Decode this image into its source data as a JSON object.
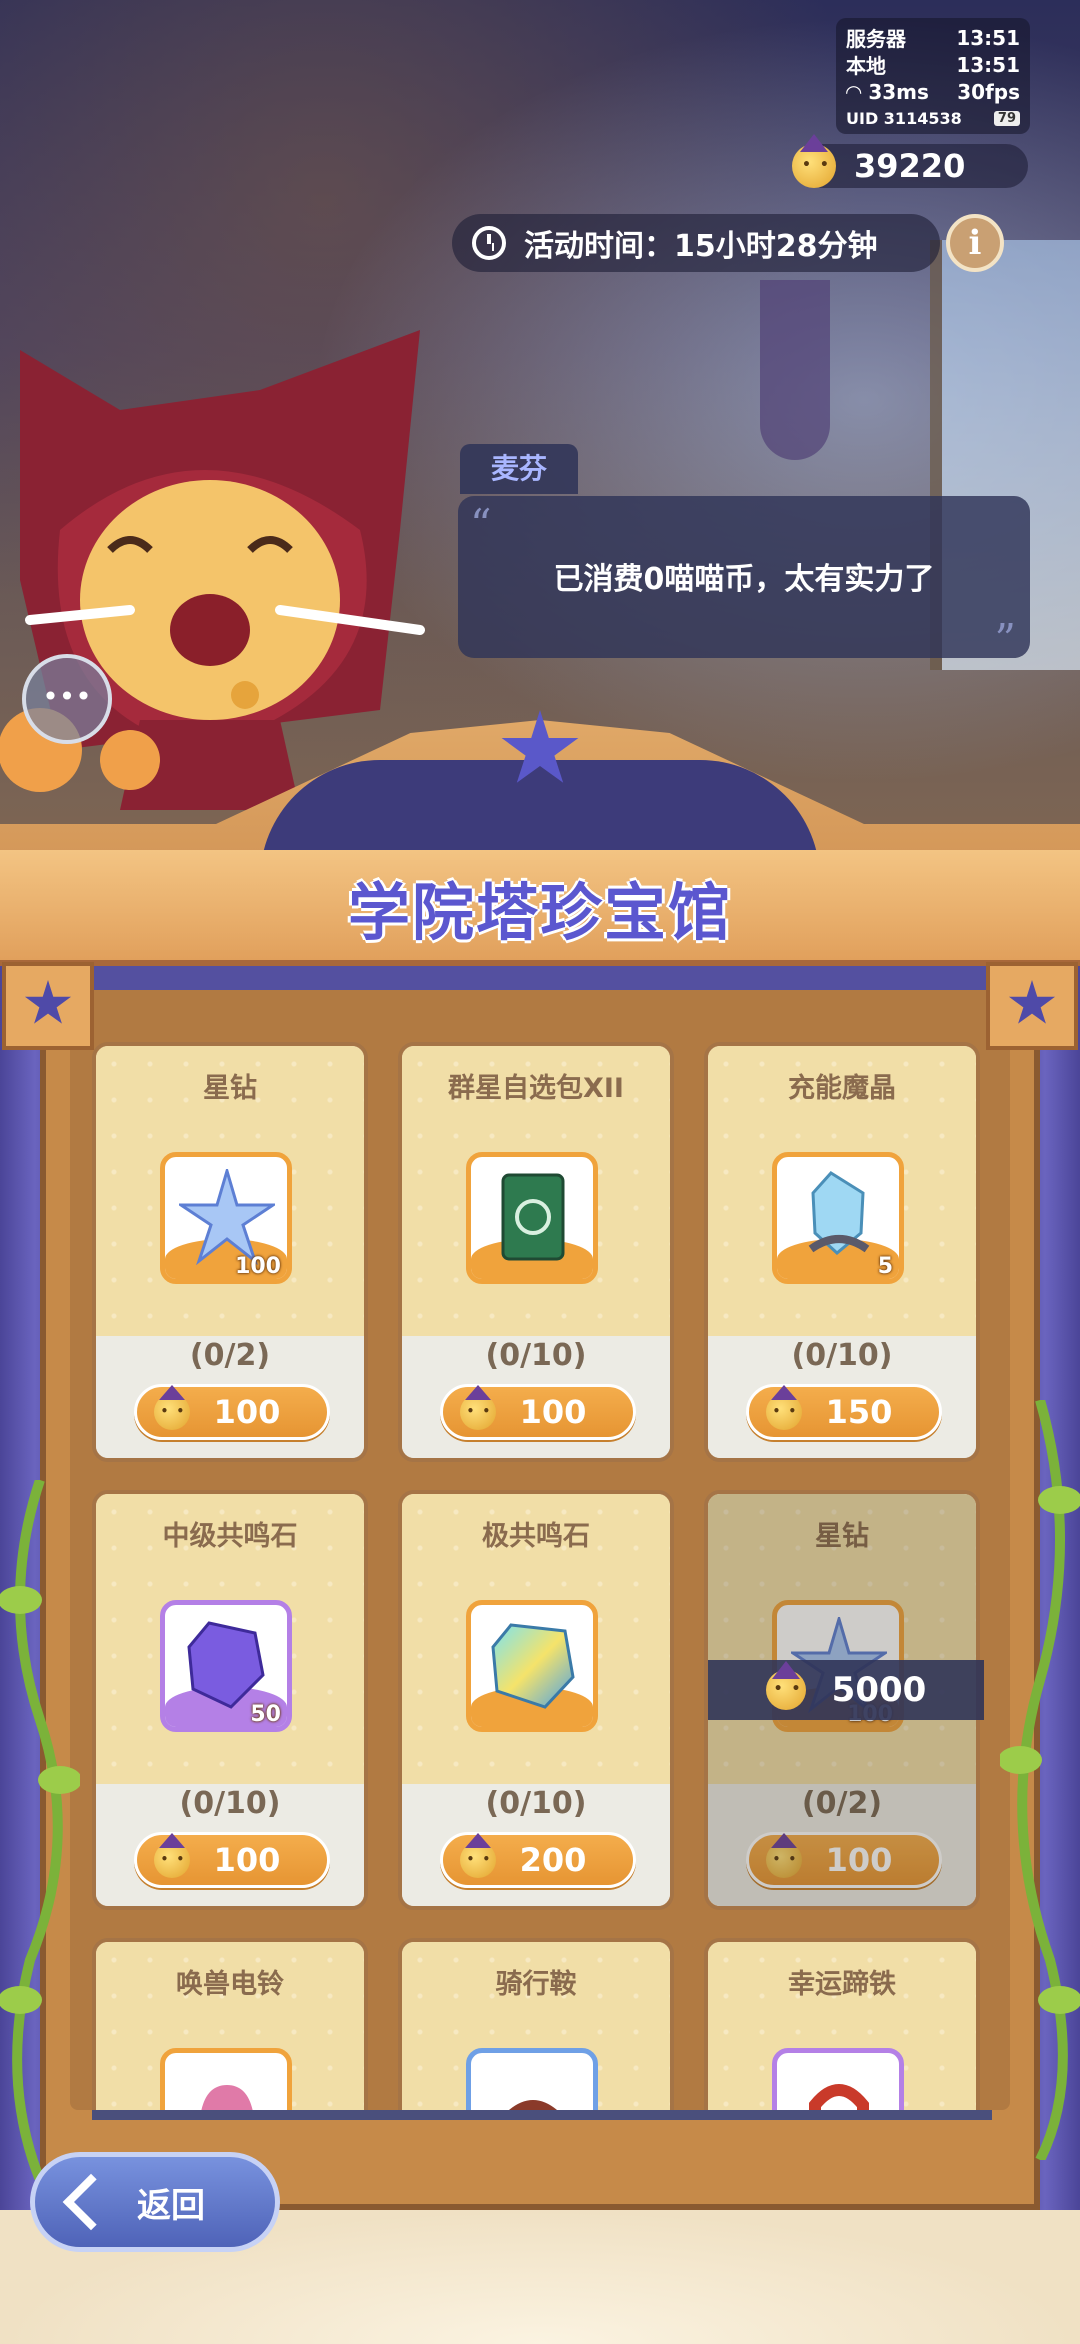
{
  "status": {
    "server_label": "服务器",
    "server_time": "13:51",
    "local_label": "本地",
    "local_time": "13:51",
    "ping": "33ms",
    "fps": "30fps",
    "uid": "UID 3114538",
    "battery": "79"
  },
  "currency": {
    "balance": "39220",
    "icon": "cat-coin-icon"
  },
  "event": {
    "timer_label": "活动时间：15小时28分钟",
    "info": "i"
  },
  "npc": {
    "speaker": "麦芬",
    "message": "已消费0喵喵币，太有实力了",
    "quote_open": "“",
    "quote_close": "”"
  },
  "shop": {
    "title": "学院塔珍宝馆",
    "items": [
      {
        "name": "星钻",
        "qty": "100",
        "limit": "(0/2)",
        "price": "100",
        "frame": "orange",
        "icon": "star-diamond-icon"
      },
      {
        "name": "群星自选包XII",
        "qty": "",
        "limit": "(0/10)",
        "price": "100",
        "frame": "orange",
        "icon": "card-pack-icon"
      },
      {
        "name": "充能魔晶",
        "qty": "5",
        "limit": "(0/10)",
        "price": "150",
        "frame": "orange",
        "icon": "magic-crystal-icon"
      },
      {
        "name": "中级共鸣石",
        "qty": "50",
        "limit": "(0/10)",
        "price": "100",
        "frame": "purple",
        "icon": "purple-gem-icon"
      },
      {
        "name": "极共鸣石",
        "qty": "",
        "limit": "(0/10)",
        "price": "200",
        "frame": "orange",
        "icon": "rainbow-gem-icon"
      },
      {
        "name": "星钻",
        "qty": "100",
        "limit": "(0/2)",
        "price": "100",
        "frame": "orange",
        "icon": "star-diamond-icon"
      },
      {
        "name": "唤兽电铃",
        "qty": "",
        "limit": "",
        "price": "",
        "frame": "orange",
        "icon": "bell-icon"
      },
      {
        "name": "骑行鞍",
        "qty": "",
        "limit": "",
        "price": "",
        "frame": "blue",
        "icon": "saddle-icon"
      },
      {
        "name": "幸运蹄铁",
        "qty": "",
        "limit": "",
        "price": "",
        "frame": "purple",
        "icon": "horseshoe-icon"
      }
    ],
    "highlight_price": "5000"
  },
  "back_button": {
    "label": "返回"
  },
  "colors": {
    "title": "#5b57cf",
    "price_btn": "#f0a33c",
    "panel": "#303458"
  }
}
